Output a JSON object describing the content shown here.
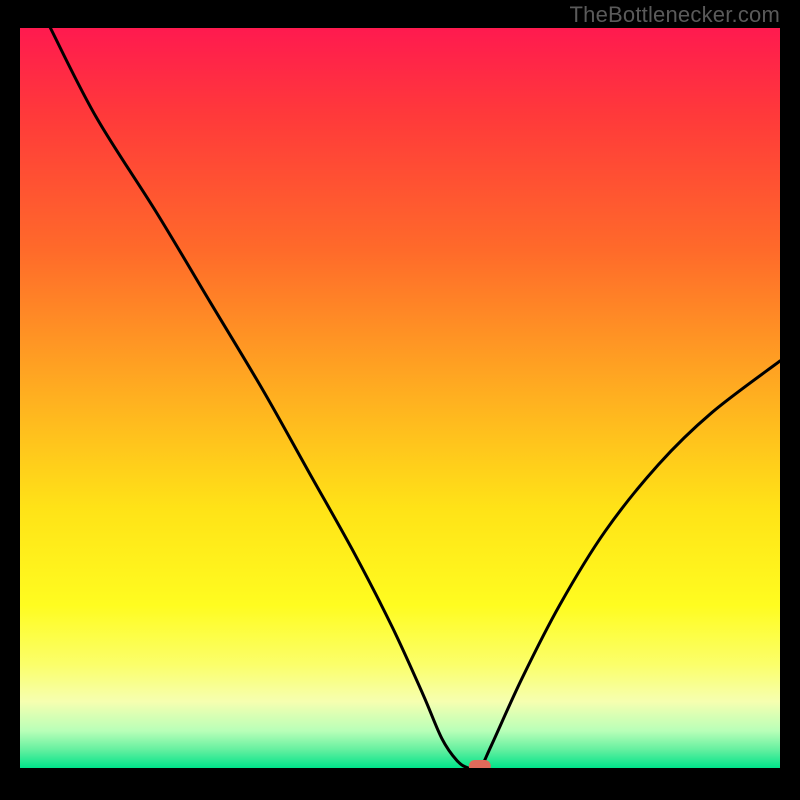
{
  "watermark": "TheBottlenecker.com",
  "chart_data": {
    "type": "line",
    "title": "",
    "xlabel": "",
    "ylabel": "",
    "xlim": [
      0,
      100
    ],
    "ylim": [
      0,
      100
    ],
    "background_gradient": {
      "stops": [
        {
          "offset": 0.0,
          "color": "#ff1a4f"
        },
        {
          "offset": 0.12,
          "color": "#ff3a3a"
        },
        {
          "offset": 0.3,
          "color": "#ff6a2a"
        },
        {
          "offset": 0.5,
          "color": "#ffb020"
        },
        {
          "offset": 0.65,
          "color": "#ffe317"
        },
        {
          "offset": 0.78,
          "color": "#fffc20"
        },
        {
          "offset": 0.86,
          "color": "#fbff6a"
        },
        {
          "offset": 0.91,
          "color": "#f6ffb0"
        },
        {
          "offset": 0.95,
          "color": "#b8ffb8"
        },
        {
          "offset": 0.975,
          "color": "#66f0a0"
        },
        {
          "offset": 1.0,
          "color": "#00e38a"
        }
      ]
    },
    "series": [
      {
        "name": "bottleneck-curve",
        "x": [
          4,
          10,
          18,
          25,
          32,
          38,
          44,
          49,
          53,
          55.5,
          57.5,
          59,
          60.5,
          62,
          66,
          71,
          77,
          84,
          91,
          100
        ],
        "y": [
          100,
          88,
          75,
          63,
          51,
          40,
          29,
          19,
          10,
          4,
          1,
          0,
          0,
          3,
          12,
          22,
          32,
          41,
          48,
          55
        ]
      }
    ],
    "marker": {
      "name": "sweet-spot-marker",
      "x": 60.5,
      "y": 0,
      "color": "#e06a5a"
    }
  }
}
